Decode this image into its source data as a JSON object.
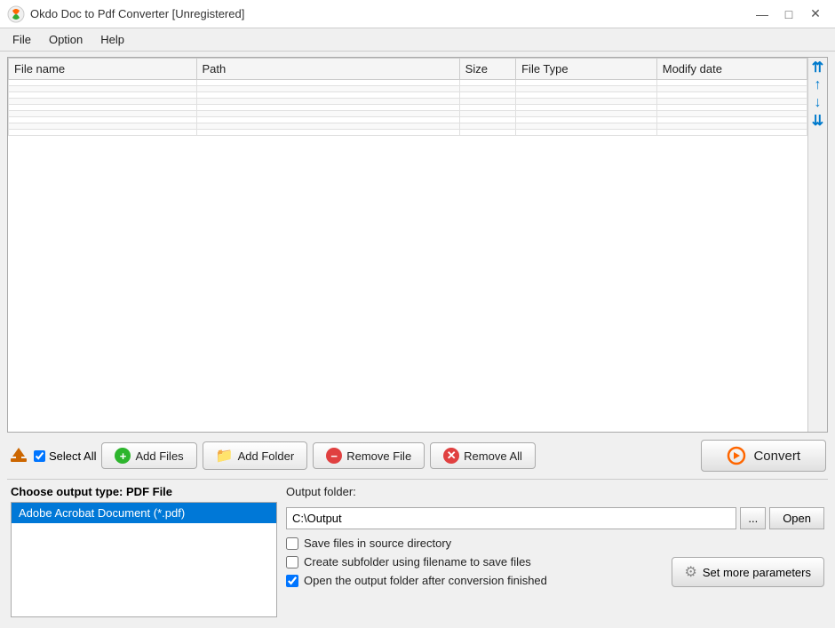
{
  "titleBar": {
    "title": "Okdo Doc to Pdf Converter [Unregistered]",
    "minBtn": "—",
    "maxBtn": "□",
    "closeBtn": "✕"
  },
  "menuBar": {
    "items": [
      "File",
      "Option",
      "Help"
    ]
  },
  "fileTable": {
    "columns": [
      {
        "label": "File name",
        "key": "filename"
      },
      {
        "label": "Path",
        "key": "path"
      },
      {
        "label": "Size",
        "key": "size"
      },
      {
        "label": "File Type",
        "key": "filetype"
      },
      {
        "label": "Modify date",
        "key": "modifydate"
      }
    ],
    "rows": []
  },
  "scrollButtons": {
    "top": "⇈",
    "up": "↑",
    "down": "↓",
    "bottom": "⇊"
  },
  "toolbar": {
    "selectAllLabel": "Select All",
    "addFilesLabel": "Add Files",
    "addFolderLabel": "Add Folder",
    "removeFileLabel": "Remove File",
    "removeAllLabel": "Remove All",
    "convertLabel": "Convert"
  },
  "outputType": {
    "label": "Choose output type:",
    "currentType": "PDF File",
    "items": [
      "Adobe Acrobat Document (*.pdf)"
    ]
  },
  "outputFolder": {
    "label": "Output folder:",
    "path": "C:\\Output",
    "browseBtnLabel": "...",
    "openBtnLabel": "Open",
    "saveInSourceLabel": "Save files in source directory",
    "createSubfolderLabel": "Create subfolder using filename to save files",
    "openAfterLabel": "Open the output folder after conversion finished",
    "saveInSourceChecked": false,
    "createSubfolderChecked": false,
    "openAfterChecked": true,
    "setParamsLabel": "Set more parameters"
  }
}
